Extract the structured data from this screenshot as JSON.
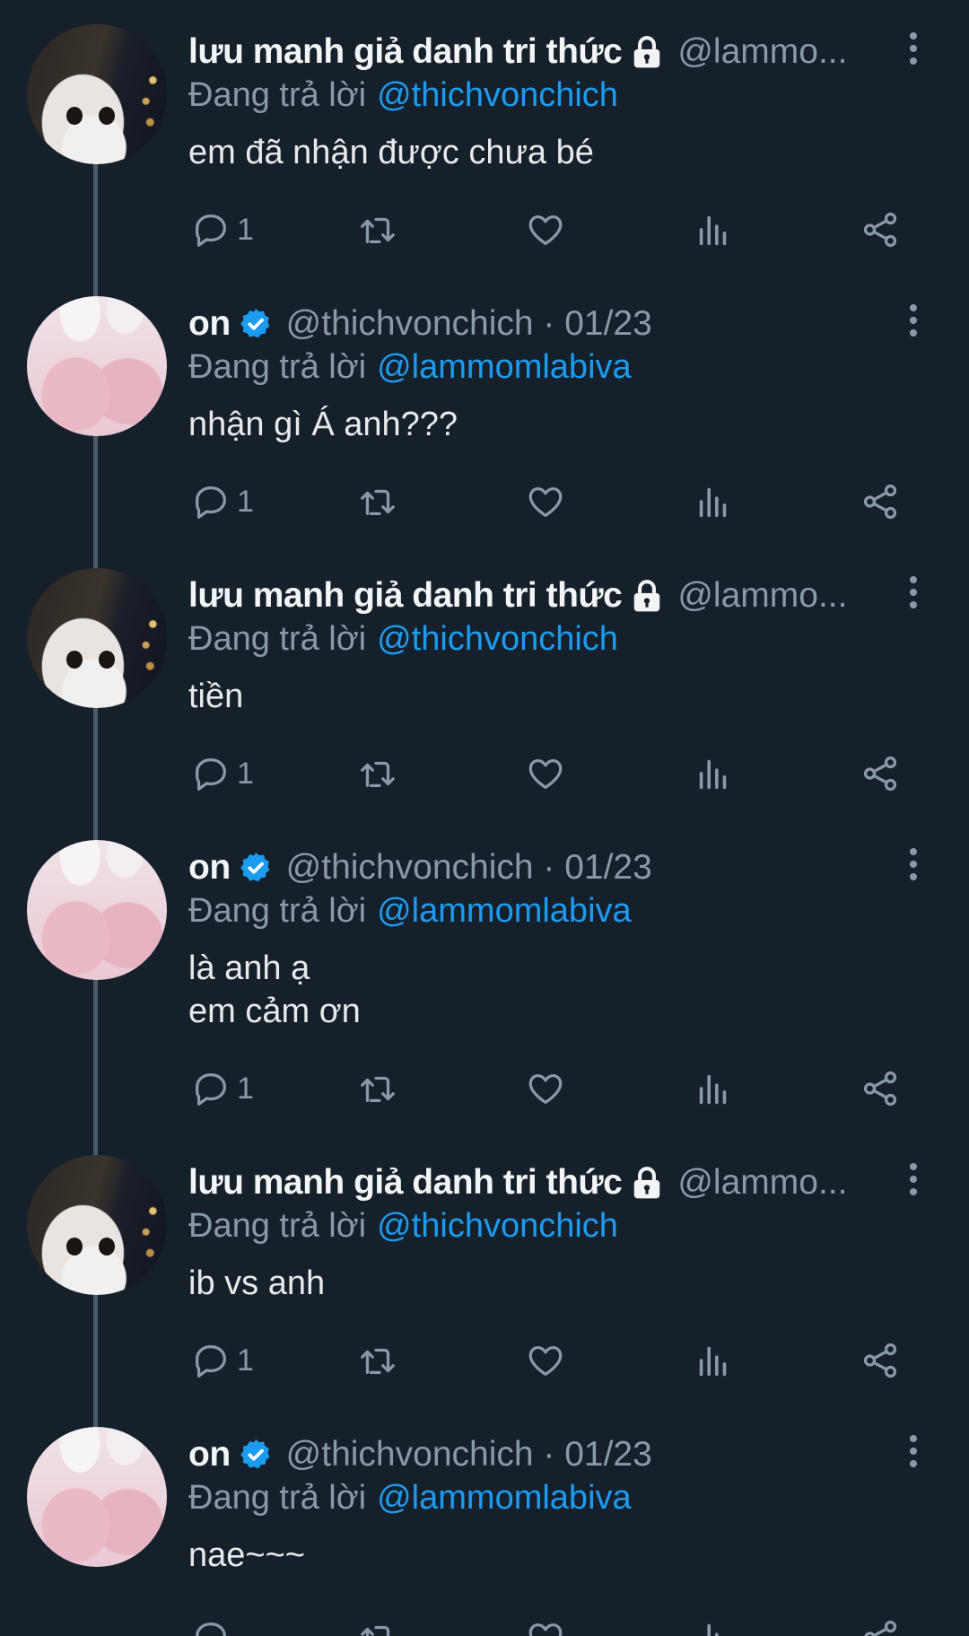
{
  "strings": {
    "replying_to": "Đang trả lời"
  },
  "accounts": {
    "lammom": {
      "display_name": "lưu manh giả danh tri thức",
      "handle": "@lammo...",
      "protected": true,
      "avatar": "white-cat-photo"
    },
    "thichvonchich": {
      "display_name": "on",
      "handle": "@thichvonchich · 01/23",
      "verified": true,
      "avatar": "pink-socks-photo"
    }
  },
  "tweets": [
    {
      "name": "lưu manh giả danh tri thức",
      "handle": "@lammo...",
      "reply_to": "@thichvonchich",
      "text": "em đã nhận được chưa bé",
      "reply_count": "1"
    },
    {
      "name": "on",
      "handle": "@thichvonchich · 01/23",
      "reply_to": "@lammomlabiva",
      "text": "nhận gì Á anh???",
      "reply_count": "1"
    },
    {
      "name": "lưu manh giả danh tri thức",
      "handle": "@lammo...",
      "reply_to": "@thichvonchich",
      "text": "tiền",
      "reply_count": "1"
    },
    {
      "name": "on",
      "handle": "@thichvonchich · 01/23",
      "reply_to": "@lammomlabiva",
      "text": "là anh ạ\nem cảm ơn",
      "reply_count": "1"
    },
    {
      "name": "lưu manh giả danh tri thức",
      "handle": "@lammo...",
      "reply_to": "@thichvonchich",
      "text": "ib vs anh",
      "reply_count": "1"
    },
    {
      "name": "on",
      "handle": "@thichvonchich · 01/23",
      "reply_to": "@lammomlabiva",
      "text": "nae~~~",
      "reply_count": ""
    }
  ],
  "icons": {
    "reply": "reply-icon",
    "retweet": "retweet-icon",
    "like": "heart-icon",
    "views": "analytics-icon",
    "share": "share-icon",
    "more": "more-vertical-icon",
    "lock": "lock-icon",
    "verified": "verified-badge-icon"
  },
  "colors": {
    "background": "#15202b",
    "text": "#e7e9ea",
    "muted": "#8b98a5",
    "accent": "#1d9bf0",
    "thread_line": "#4c5b69"
  }
}
